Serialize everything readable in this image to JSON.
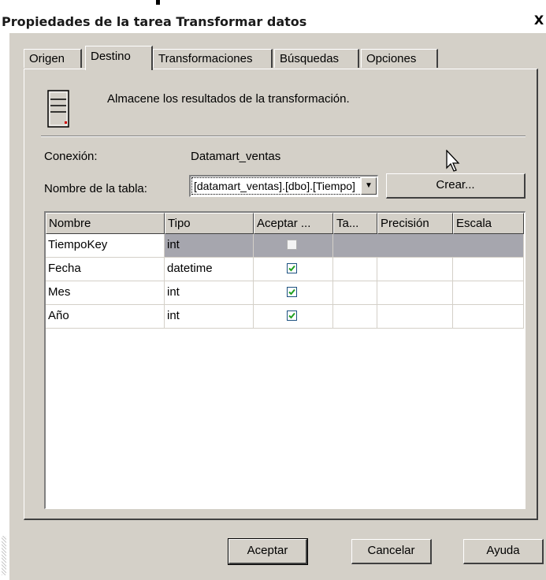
{
  "window": {
    "title": "Propiedades de la tarea Transformar datos",
    "close": "X"
  },
  "tabs": [
    {
      "label": "Origen",
      "active": false
    },
    {
      "label": "Destino",
      "active": true
    },
    {
      "label": "Transformaciones",
      "active": false
    },
    {
      "label": "Búsquedas",
      "active": false
    },
    {
      "label": "Opciones",
      "active": false
    }
  ],
  "destino": {
    "description": "Almacene los resultados de la transformación.",
    "connection_label": "Conexión:",
    "connection_value": "Datamart_ventas",
    "table_label": "Nombre de la tabla:",
    "table_value": "[datamart_ventas].[dbo].[Tiempo]",
    "create_button": "Crear..."
  },
  "grid": {
    "columns": [
      "Nombre",
      "Tipo",
      "Aceptar ...",
      "Ta...",
      "Precisión",
      "Escala"
    ],
    "rows": [
      {
        "nombre": "TiempoKey",
        "tipo": "int",
        "aceptar": false,
        "selected": true
      },
      {
        "nombre": "Fecha",
        "tipo": "datetime",
        "aceptar": true,
        "selected": false
      },
      {
        "nombre": "Mes",
        "tipo": "int",
        "aceptar": true,
        "selected": false
      },
      {
        "nombre": "Año",
        "tipo": "int",
        "aceptar": true,
        "selected": false
      }
    ]
  },
  "buttons": {
    "ok": "Aceptar",
    "cancel": "Cancelar",
    "help": "Ayuda"
  },
  "colors": {
    "dialog_bg": "#d4d0c8",
    "selection": "#a6a6ae",
    "check": "#21a121"
  }
}
